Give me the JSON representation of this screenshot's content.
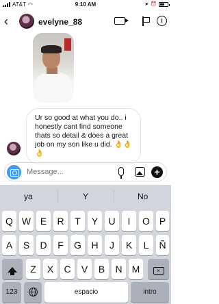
{
  "status_bar": {
    "carrier": "AT&T",
    "time": "9:10 AM",
    "battery_level": 0.55
  },
  "header": {
    "username": "evelyne_88",
    "back_icon": "chevron-left-icon",
    "video_icon": "video-call-icon",
    "flag_icon": "flag-icon",
    "info_icon": "info-icon",
    "info_glyph": "i"
  },
  "messages": [
    {
      "type": "image",
      "alt": "photo"
    },
    {
      "type": "text",
      "text": "Ur so good at what you do.. i honestly cant find someone thats so detail & does a great job on my son like u did. 👌👌👌"
    }
  ],
  "composer": {
    "placeholder": "Message...",
    "plus_label": "+"
  },
  "keyboard": {
    "suggestions": [
      "ya",
      "Y",
      "No"
    ],
    "row1": [
      "Q",
      "W",
      "E",
      "R",
      "T",
      "Y",
      "U",
      "I",
      "O",
      "P"
    ],
    "row2": [
      "A",
      "S",
      "D",
      "F",
      "G",
      "H",
      "J",
      "K",
      "L",
      "Ñ"
    ],
    "row3": [
      "Z",
      "X",
      "C",
      "V",
      "B",
      "N",
      "M"
    ],
    "numbers_key": "123",
    "space_key": "espacio",
    "return_key": "intro",
    "backspace_glyph": "×"
  },
  "colors": {
    "accent": "#3f9af0",
    "keyboard_bg": "#d2d5db"
  }
}
